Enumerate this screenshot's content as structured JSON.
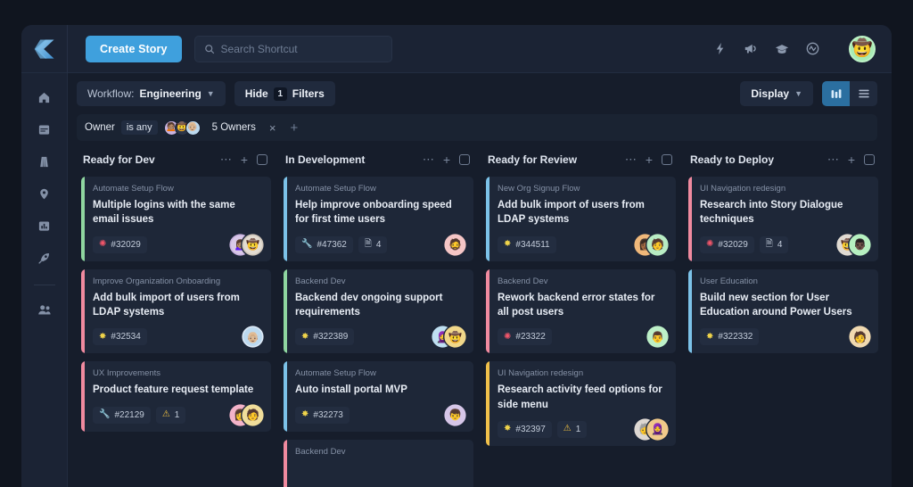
{
  "app": {
    "logo_name": "shortcut-logo",
    "accent": "#3fa0dd",
    "window_bg": "#1a2233",
    "board_bg": "#161d2b",
    "card_bg": "#1e2738"
  },
  "topbar": {
    "create_label": "Create Story",
    "search_placeholder": "Search Shortcut",
    "icons": [
      {
        "name": "lightning-icon",
        "glyph": "⚡"
      },
      {
        "name": "megaphone-icon",
        "glyph": "📣"
      },
      {
        "name": "graduation-cap-icon",
        "glyph": "🎓"
      },
      {
        "name": "activity-icon",
        "glyph": "〰"
      }
    ],
    "avatar": {
      "name": "user-avatar",
      "emoji": "🤠",
      "bg": "#a8ecb4"
    }
  },
  "sidebar": {
    "items": [
      {
        "name": "sidebar-item-home",
        "icon": "home-icon"
      },
      {
        "name": "sidebar-item-stories",
        "icon": "docs-icon"
      },
      {
        "name": "sidebar-item-roadmap",
        "icon": "road-icon"
      },
      {
        "name": "sidebar-item-milestones",
        "icon": "pin-icon"
      },
      {
        "name": "sidebar-item-reports",
        "icon": "chart-icon"
      },
      {
        "name": "sidebar-item-iterations",
        "icon": "rocket-icon"
      },
      {
        "name": "sidebar-item-team",
        "icon": "people-icon"
      }
    ]
  },
  "controls": {
    "workflow_prefix": "Workflow:",
    "workflow_value": "Engineering",
    "hide_label": "Hide",
    "filters_count": "1",
    "filters_label": "Filters",
    "display_label": "Display",
    "view_board": "board-view",
    "view_list": "list-view"
  },
  "filterbar": {
    "field": "Owner",
    "operator": "is any",
    "value": "5 Owners",
    "avatars": [
      "🙍🏽",
      "🤠",
      "👴🏼"
    ],
    "remove_label": "×",
    "add_label": "+"
  },
  "board": {
    "columns": [
      {
        "title": "Ready for Dev",
        "cards": [
          {
            "epic": "Automate Setup Flow",
            "title": "Multiple logins with the same email issues",
            "accent": "#8fd6a0",
            "badges": [
              {
                "type": "bug",
                "glyph": "✺",
                "color": "#f2566a",
                "text": "#32029"
              }
            ],
            "avatars": [
              {
                "emoji": "🙍🏽‍♀️",
                "bg": "#d9c8e8",
                "ring": "#c9b3e0"
              },
              {
                "emoji": "🤠",
                "bg": "#e3dcd2",
                "ring": "#cfc6ba"
              }
            ]
          },
          {
            "epic": "Improve Organization Onboarding",
            "title": "Add bulk import of users from LDAP systems",
            "accent": "#f08a9f",
            "badges": [
              {
                "type": "feature",
                "glyph": "✸",
                "color": "#f0d44a",
                "text": "#32534"
              }
            ],
            "avatars": [
              {
                "emoji": "👴🏼",
                "bg": "#bcd9ef",
                "ring": "#dce9f6"
              }
            ]
          },
          {
            "epic": "UX Improvements",
            "title": "Product feature request template",
            "accent": "#f08a9f",
            "badges": [
              {
                "type": "chore",
                "glyph": "🔧",
                "color": "#5b9ee0",
                "text": "#22129"
              },
              {
                "type": "blocker",
                "glyph": "⚠",
                "color": "#f0c040",
                "text": "1"
              }
            ],
            "avatars": [
              {
                "emoji": "👩",
                "bg": "#f3b3c9",
                "ring": "#f3b3c9"
              },
              {
                "emoji": "🧑",
                "bg": "#f0dd9a",
                "ring": "#f0dd9a"
              }
            ]
          }
        ]
      },
      {
        "title": "In Development",
        "cards": [
          {
            "epic": "Automate Setup Flow",
            "title": "Help improve onboarding speed for first time users",
            "accent": "#7cc2e8",
            "badges": [
              {
                "type": "chore",
                "glyph": "🔧",
                "color": "#5b9ee0",
                "text": "#47362"
              },
              {
                "type": "docs",
                "glyph": "🗎",
                "color": "#b8c3d2",
                "text": "4"
              }
            ],
            "avatars": [
              {
                "emoji": "🧔",
                "bg": "#f5c6c6",
                "ring": "#f5c6c6"
              }
            ]
          },
          {
            "epic": "Backend Dev",
            "title": "Backend dev ongoing support requirements",
            "accent": "#8fd6a0",
            "badges": [
              {
                "type": "feature",
                "glyph": "✸",
                "color": "#f0d44a",
                "text": "#322389"
              }
            ],
            "avatars": [
              {
                "emoji": "🧕",
                "bg": "#bfe0f2",
                "ring": "#bfe0f2"
              },
              {
                "emoji": "🤠",
                "bg": "#f0d78a",
                "ring": "#f0d78a"
              }
            ]
          },
          {
            "epic": "Automate Setup Flow",
            "title": "Auto install portal MVP",
            "accent": "#7cc2e8",
            "badges": [
              {
                "type": "feature",
                "glyph": "✸",
                "color": "#f0d44a",
                "text": "#32273"
              }
            ],
            "avatars": [
              {
                "emoji": "👦",
                "bg": "#d6c6e8",
                "ring": "#d6c6e8"
              }
            ]
          },
          {
            "epic": "Backend Dev",
            "title": "",
            "accent": "#f08a9f",
            "badges": [],
            "avatars": []
          }
        ]
      },
      {
        "title": "Ready for Review",
        "cards": [
          {
            "epic": "New Org Signup Flow",
            "title": "Add bulk import of users from LDAP systems",
            "accent": "#7cc2e8",
            "badges": [
              {
                "type": "feature",
                "glyph": "✸",
                "color": "#f0d44a",
                "text": "#344511"
              }
            ],
            "avatars": [
              {
                "emoji": "👩🏾",
                "bg": "#f0b87a",
                "ring": "#f0b87a"
              },
              {
                "emoji": "🧑",
                "bg": "#b8ecc3",
                "ring": "#b8ecc3"
              }
            ]
          },
          {
            "epic": "Backend Dev",
            "title": "Rework backend error states for all post users",
            "accent": "#f08a9f",
            "badges": [
              {
                "type": "bug",
                "glyph": "✺",
                "color": "#f2566a",
                "text": "#23322"
              }
            ],
            "avatars": [
              {
                "emoji": "👨",
                "bg": "#bdf0c8",
                "ring": "#bdf0c8"
              }
            ]
          },
          {
            "epic": "UI Navigation redesign",
            "title": "Research activity feed options for side menu",
            "accent": "#f0c04a",
            "badges": [
              {
                "type": "feature",
                "glyph": "✸",
                "color": "#f0d44a",
                "text": "#32397"
              },
              {
                "type": "blocker",
                "glyph": "⚠",
                "color": "#f0c040",
                "text": "1"
              }
            ],
            "avatars": [
              {
                "emoji": "🧓",
                "bg": "#ddd7d2",
                "ring": "#ddd7d2"
              },
              {
                "emoji": "🧕",
                "bg": "#f0c98a",
                "ring": "#f0c98a"
              }
            ]
          }
        ]
      },
      {
        "title": "Ready to Deploy",
        "cards": [
          {
            "epic": "UI Navigation redesign",
            "title": "Research into Story Dialogue techniques",
            "accent": "#f08a9f",
            "badges": [
              {
                "type": "bug",
                "glyph": "✺",
                "color": "#f2566a",
                "text": "#32029"
              },
              {
                "type": "docs",
                "glyph": "🗎",
                "color": "#b8c3d2",
                "text": "4"
              }
            ],
            "avatars": [
              {
                "emoji": "🤠",
                "bg": "#e0dad2",
                "ring": "#e0dad2"
              },
              {
                "emoji": "👨🏿",
                "bg": "#b6f0c0",
                "ring": "#b6f0c0"
              }
            ]
          },
          {
            "epic": "User Education",
            "title": "Build new section for User Education around Power Users",
            "accent": "#7cc2e8",
            "badges": [
              {
                "type": "feature",
                "glyph": "✸",
                "color": "#f0d44a",
                "text": "#322332"
              }
            ],
            "avatars": [
              {
                "emoji": "🧑",
                "bg": "#f0d9b0",
                "ring": "#f0d9b0"
              }
            ]
          }
        ]
      }
    ],
    "col_actions": {
      "menu": "⋯",
      "add": "+",
      "select": "column-checkbox"
    }
  }
}
